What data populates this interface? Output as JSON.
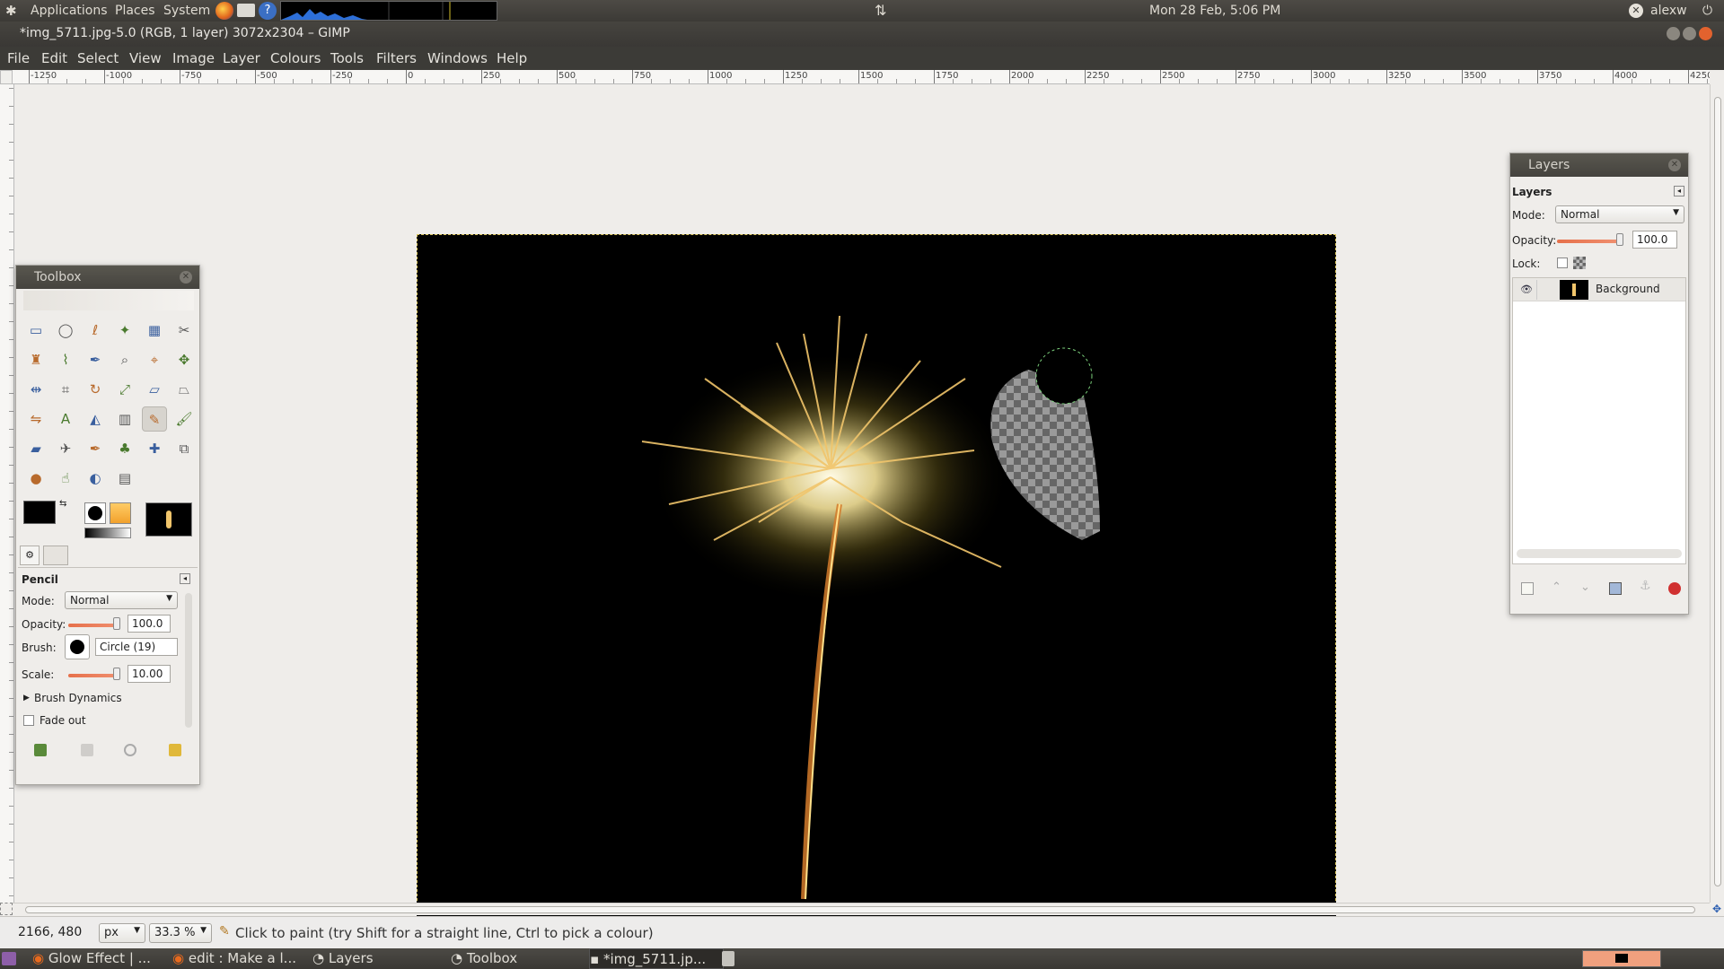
{
  "top_panel": {
    "applications": "Applications",
    "places": "Places",
    "system": "System",
    "datetime": "Mon 28 Feb,  5:06 PM",
    "user": "alexw"
  },
  "window": {
    "title": "*img_5711.jpg-5.0 (RGB, 1 layer) 3072x2304 – GIMP"
  },
  "menu": [
    "File",
    "Edit",
    "Select",
    "View",
    "Image",
    "Layer",
    "Colours",
    "Tools",
    "Filters",
    "Windows",
    "Help"
  ],
  "ruler": {
    "h_ticks": [
      "-1250",
      "-1000",
      "-750",
      "-500",
      "-250",
      "0",
      "250",
      "500",
      "750",
      "1000",
      "1250",
      "1500",
      "1750",
      "2000",
      "2250",
      "2500",
      "2750",
      "3000",
      "3250",
      "3500",
      "3750",
      "4000",
      "4250"
    ]
  },
  "toolbox": {
    "title": "Toolbox",
    "tool_options_title": "Pencil",
    "mode_label": "Mode:",
    "mode_value": "Normal",
    "opacity_label": "Opacity:",
    "opacity_value": "100.0",
    "brush_label": "Brush:",
    "brush_value": "Circle (19)",
    "scale_label": "Scale:",
    "scale_value": "10.00",
    "brush_dynamics": "Brush Dynamics",
    "fade_out": "Fade out"
  },
  "layers": {
    "title": "Layers",
    "section": "Layers",
    "mode_label": "Mode:",
    "mode_value": "Normal",
    "opacity_label": "Opacity:",
    "opacity_value": "100.0",
    "lock_label": "Lock:",
    "layer_name": "Background"
  },
  "status": {
    "coords": "2166, 480",
    "unit": "px",
    "zoom": "33.3 %",
    "message": "Click to paint (try Shift for a straight line, Ctrl to pick a colour)"
  },
  "taskbar": {
    "items": [
      "Glow Effect | ...",
      "edit : Make a l...",
      "Layers",
      "Toolbox",
      "*img_5711.jp..."
    ]
  },
  "colors": {
    "panel_dark": "#3c3b37",
    "accent_slider": "#e6704a",
    "selection_marching": "#d8c35a"
  }
}
